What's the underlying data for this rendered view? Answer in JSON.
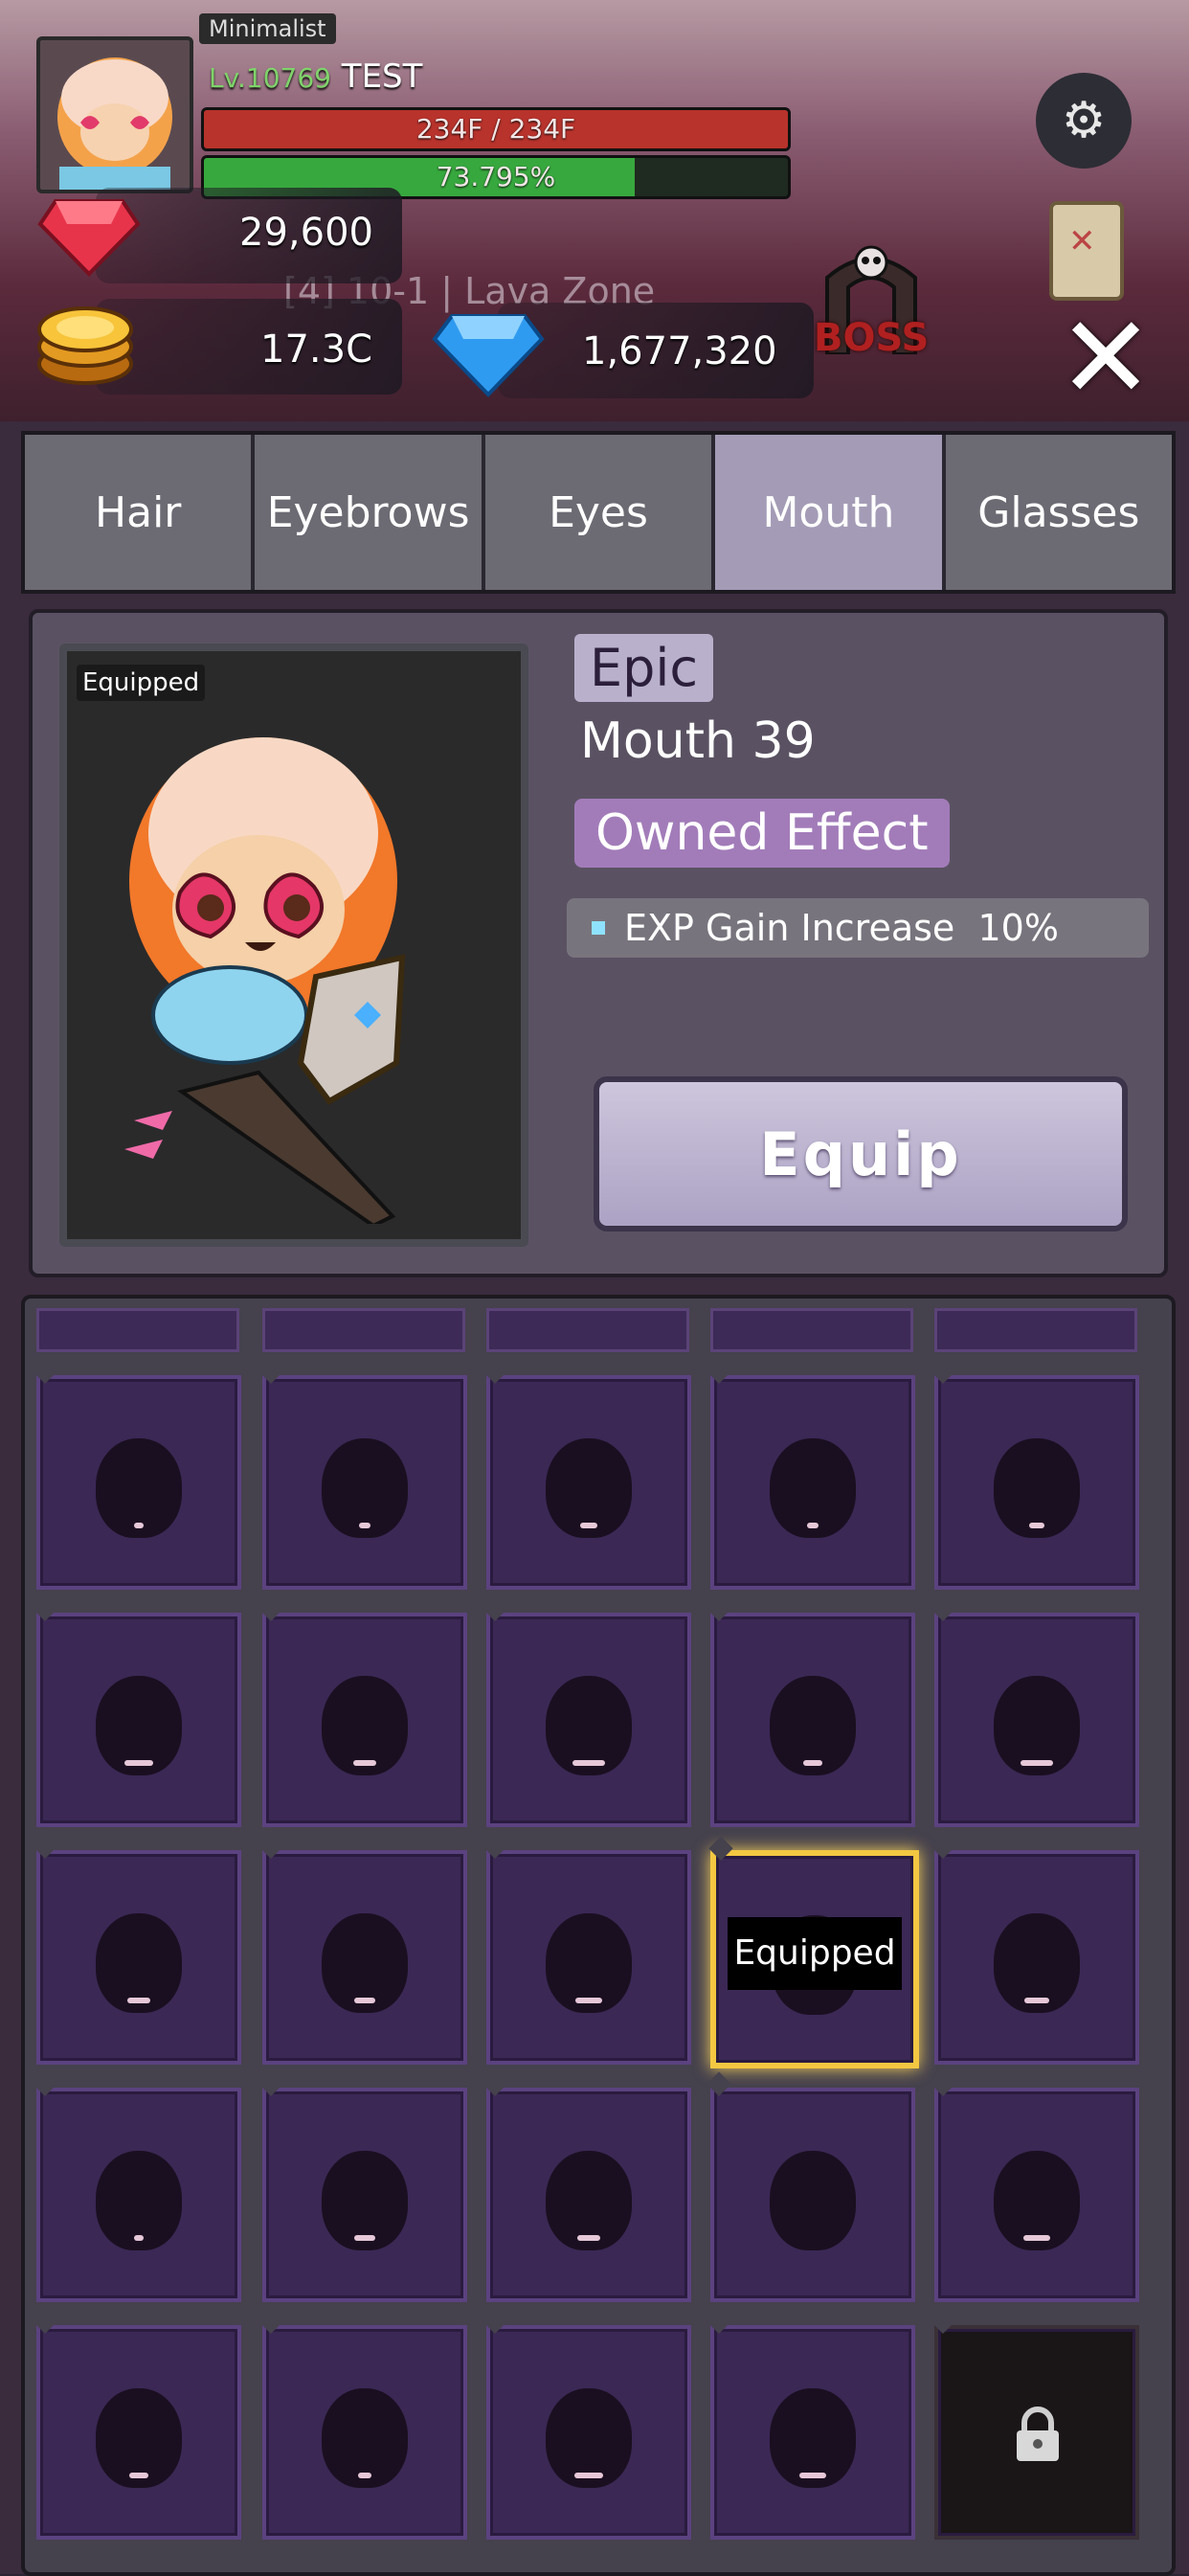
{
  "header": {
    "title_tag": "Minimalist",
    "level_prefix": "Lv.",
    "level_number": "10769",
    "player_name": "TEST",
    "hp_text": "234F / 234F",
    "hp_fraction": 1.0,
    "exp_text": "73.795%",
    "exp_fraction": 0.73795,
    "zone_text": "[4] 10-1 | Lava Zone",
    "boss_text": "BOSS"
  },
  "currency": {
    "ruby": "29,600",
    "gold": "17.3C",
    "diamond": "1,677,320"
  },
  "icons": {
    "settings": "gear-icon",
    "quest": "scroll-icon",
    "close": "close-icon",
    "lock": "lock-icon"
  },
  "tabs": [
    {
      "label": "Hair",
      "active": false
    },
    {
      "label": "Eyebrows",
      "active": false
    },
    {
      "label": "Eyes",
      "active": false
    },
    {
      "label": "Mouth",
      "active": true
    },
    {
      "label": "Glasses",
      "active": false
    }
  ],
  "detail": {
    "equipped_badge": "Equipped",
    "rarity": "Epic",
    "item_name": "Mouth 39",
    "owned_effect_label": "Owned Effect",
    "effect_name": "EXP Gain Increase",
    "effect_value": "10%",
    "equip_button": "Equip"
  },
  "grid": {
    "equipped_badge": "Equipped",
    "equipped_index": 13,
    "locked_index": 24
  },
  "colors": {
    "active_tab": "#a49cb6",
    "inactive_tab": "#6c6a72",
    "rarity_epic": "#b9b1cc",
    "owned_effect": "#a27cb9",
    "equipped_border": "#f3c742",
    "hp": "#b8332c",
    "exp": "#37a83e"
  }
}
